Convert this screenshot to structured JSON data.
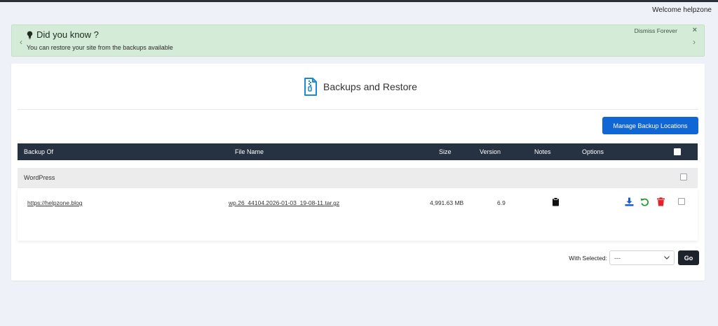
{
  "header": {
    "welcome": "Welcome helpzone"
  },
  "tip": {
    "title": "Did you know ?",
    "text": "You can restore your site from the backups available",
    "dismiss": "Dismiss Forever",
    "close": "×",
    "prev": "‹",
    "next": "›"
  },
  "page": {
    "title": "Backups and Restore"
  },
  "toolbar": {
    "manage_label": "Manage Backup Locations"
  },
  "table": {
    "columns": [
      "Backup Of",
      "File Name",
      "Size",
      "Version",
      "Notes",
      "Options"
    ],
    "group": {
      "label": "WordPress"
    },
    "rows": [
      {
        "backup_of": "https://helpzone.blog",
        "file_name": "wp.26_44104.2026-01-03_19-08-11.tar.gz",
        "size": "4,991.63 MB",
        "version": "6.9"
      }
    ]
  },
  "footer": {
    "with_selected_label": "With Selected:",
    "select_value": "---",
    "go_label": "Go"
  },
  "colors": {
    "primary": "#1166d6",
    "download": "#1a5fc7",
    "restore": "#2a9a36",
    "delete": "#e0242a",
    "table_header": "#263242"
  },
  "icons": [
    "lightbulb-icon",
    "zip-file-icon",
    "clipboard-icon",
    "download-icon",
    "restore-icon",
    "trash-icon",
    "chevron-down-icon"
  ]
}
